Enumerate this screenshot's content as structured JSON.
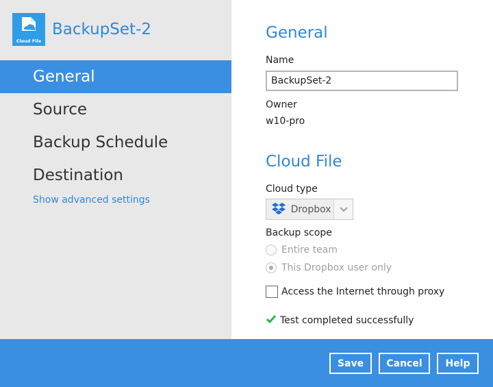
{
  "app": {
    "title": "BackupSet-2",
    "icon": "cloud-file-icon",
    "icon_caption": "Cloud File"
  },
  "sidebar": {
    "items": [
      {
        "label": "General",
        "active": true
      },
      {
        "label": "Source",
        "active": false
      },
      {
        "label": "Backup Schedule",
        "active": false
      },
      {
        "label": "Destination",
        "active": false
      }
    ],
    "advanced_link": "Show advanced settings"
  },
  "general": {
    "title": "General",
    "name_label": "Name",
    "name_value": "BackupSet-2",
    "owner_label": "Owner",
    "owner_value": "w10-pro"
  },
  "cloud_file": {
    "title": "Cloud File",
    "cloud_type_label": "Cloud type",
    "cloud_type_value": "Dropbox",
    "cloud_type_icon": "dropbox-icon",
    "backup_scope_label": "Backup scope",
    "scope_options": [
      {
        "label": "Entire team",
        "selected": false
      },
      {
        "label": "This Dropbox user only",
        "selected": true
      }
    ],
    "proxy_label": "Access the Internet through proxy",
    "proxy_checked": false,
    "status_text": "Test completed successfully",
    "status_icon": "checkmark-icon"
  },
  "footer": {
    "save_label": "Save",
    "cancel_label": "Cancel",
    "help_label": "Help"
  },
  "colors": {
    "accent": "#3a8fe0",
    "title_blue": "#2f88d8",
    "sidebar_bg": "#e8e8e8",
    "success_green": "#2db34a",
    "dropbox_blue": "#1f6fd1"
  }
}
